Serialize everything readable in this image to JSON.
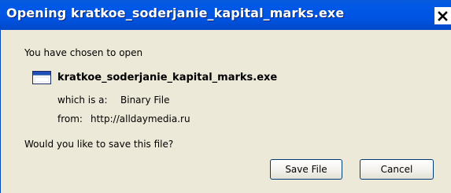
{
  "dialog": {
    "title": "Opening kratkoe_soderjanie_kapital_marks.exe",
    "close_icon": "close-icon",
    "intro_text": "You have chosen to open",
    "file": {
      "icon": "application-window-icon",
      "name": "kratkoe_soderjanie_kapital_marks.exe",
      "type_label": "which is a:",
      "type_value": "Binary File",
      "from_label": "from:",
      "from_value": "http://alldaymedia.ru"
    },
    "question": "Would you like to save this file?",
    "buttons": {
      "save": "Save File",
      "cancel": "Cancel"
    },
    "colors": {
      "titlebar": "#0054e3",
      "title_text": "#ffffff",
      "body_background": "#ece9d8",
      "button_border": "#003c74"
    }
  }
}
